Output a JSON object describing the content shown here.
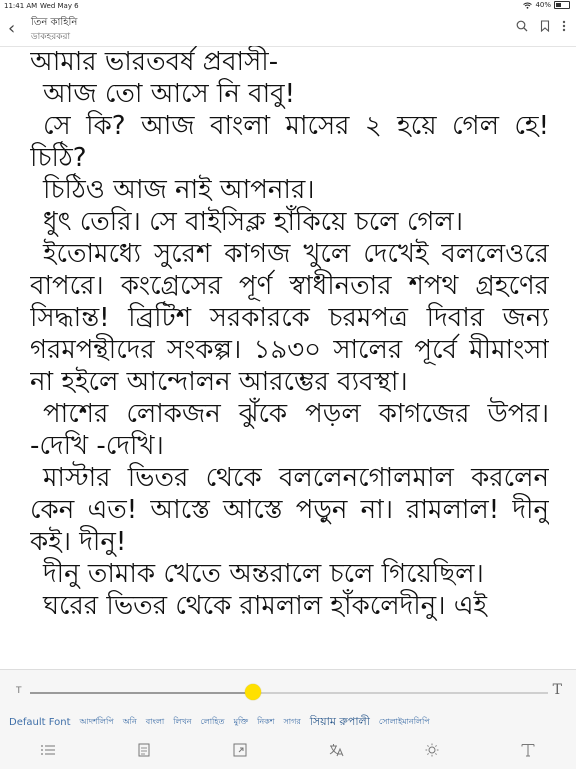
{
  "status_bar": {
    "time": "11:41 AM",
    "date": "Wed May 6",
    "battery_text": "40%",
    "battery_level": 0.4
  },
  "header": {
    "title": "তিন কাহিনি",
    "subtitle": "ডাকহরকরা"
  },
  "reader": {
    "paragraphs": [
      {
        "text": "আমার ভারতবর্ষ প্রবাসী-",
        "indent": false
      },
      {
        "text": "আজ তো আসে নি বাবু!",
        "indent": true
      },
      {
        "text": "সে কি? আজ বাংলা মাসের ২ হয়ে গেল হে! চিঠি?",
        "indent": true
      },
      {
        "text": "চিঠিও আজ নাই আপনার।",
        "indent": true
      },
      {
        "text": "ধুৎ তেরি। সে বাইসিক্ল হাঁকিয়ে চলে গেল।",
        "indent": true
      },
      {
        "text": "ইতোমধ্যে সুরেশ কাগজ খুলে দেখেই বললেওরে বাপরে। কংগ্রেসের পূর্ণ স্বাধীনতার শপথ গ্রহণের সিদ্ধান্ত! ব্রিটিশ সরকারকে চরমপত্র দিবার জন্য গরমপন্থীদের সংকল্প। ১৯৩০ সালের পূর্বে মীমাংসা না হইলে আন্দোলন আরম্ভের ব্যবস্থা।",
        "indent": true
      },
      {
        "text": "পাশের লোকজন ঝুঁকে পড়ল কাগজের উপর। -দেখি -দেখি।",
        "indent": true
      },
      {
        "text": "মাস্টার ভিতর থেকে বললেনগোলমাল করলেন কেন এত! আস্তে আস্তে পড়ুন না। রামলাল! দীনু কই। দীনু!",
        "indent": true
      },
      {
        "text": "দীনু তামাক খেতে অন্তরালে চলে গিয়েছিল।",
        "indent": true
      },
      {
        "text": "ঘরের ভিতর থেকে রামলাল হাঁকলেদীনু। এই",
        "indent": true
      }
    ]
  },
  "font_size_slider": {
    "small_label": "T",
    "large_label": "T",
    "value": 0.43
  },
  "font_options": {
    "items": [
      "Default Font",
      "আদর্শলিপি",
      "অনি",
      "বাংলা",
      "লিখন",
      "লোহিত",
      "মুক্তি",
      "নিকশ",
      "সাগর",
      "সিয়াম রুপালী",
      "সোলাইমানলিপি"
    ],
    "selected": "সিয়াম রুপালী"
  },
  "toolbar": {
    "icons": [
      "list-icon",
      "notes-icon",
      "expand-icon",
      "translate-icon",
      "brightness-icon",
      "font-icon"
    ]
  },
  "colors": {
    "accent_yellow": "#ffe000",
    "link_blue": "#3f6fa8",
    "panel_bg": "#f6f6f6"
  }
}
